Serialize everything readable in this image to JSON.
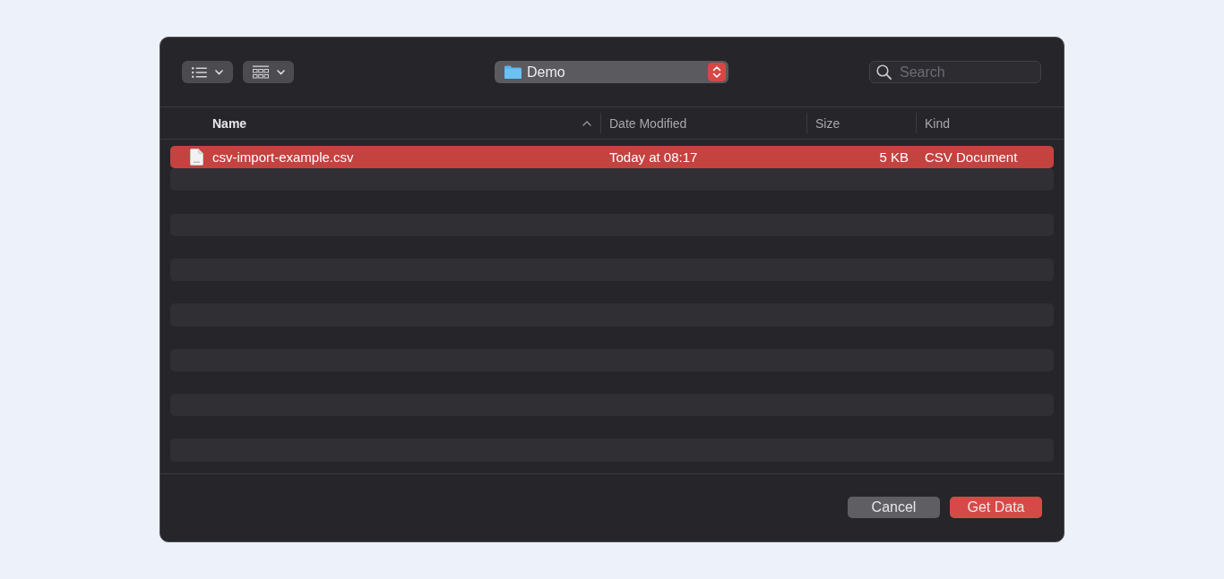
{
  "location": {
    "folder": "Demo"
  },
  "search": {
    "placeholder": "Search"
  },
  "table": {
    "columns": [
      {
        "label": "Name",
        "sorted": true
      },
      {
        "label": "Date Modified",
        "sorted": false
      },
      {
        "label": "Size",
        "sorted": false
      },
      {
        "label": "Kind",
        "sorted": false
      }
    ],
    "rows": [
      {
        "name": "csv-import-example.csv",
        "date_modified": "Today at 08:17",
        "size": "5 KB",
        "document_kind": "CSV Document",
        "selected": true
      }
    ]
  },
  "buttons": [
    {
      "label": "Cancel",
      "kind": "plain"
    },
    {
      "label": "Get Data",
      "kind": "default"
    }
  ]
}
